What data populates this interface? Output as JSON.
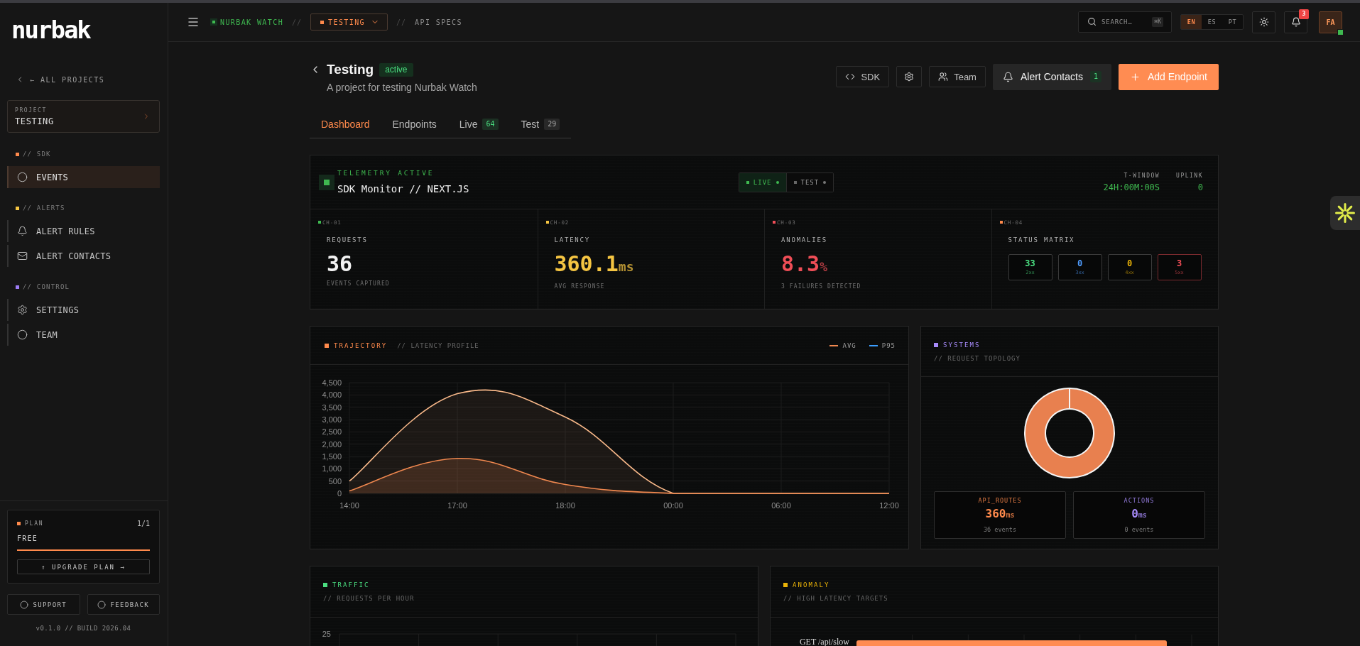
{
  "sidebar": {
    "logo": "nurbak",
    "back_link": "← ALL PROJECTS",
    "project": {
      "label": "PROJECT",
      "name": "TESTING"
    },
    "sections": [
      {
        "title": "// SDK",
        "color": "#ff8a4c",
        "items": [
          {
            "label": "EVENTS",
            "selected": true
          }
        ]
      },
      {
        "title": "// ALERTS",
        "color": "#f5c542",
        "items": [
          {
            "label": "ALERT RULES",
            "selected": false
          },
          {
            "label": "ALERT CONTACTS",
            "selected": false
          }
        ]
      },
      {
        "title": "// CONTROL",
        "color": "#9d7cf5",
        "items": [
          {
            "label": "SETTINGS",
            "selected": false
          },
          {
            "label": "TEAM",
            "selected": false
          }
        ]
      }
    ],
    "plan": {
      "label": "PLAN",
      "count": "1/1",
      "name": "FREE",
      "level": 1,
      "button": "↑ UPGRADE PLAN →"
    },
    "footer_buttons": [
      {
        "label": "SUPPORT"
      },
      {
        "label": "FEEDBACK"
      }
    ],
    "version": "v0.1.0 // BUILD 2026.04"
  },
  "topbar": {
    "breadcrumb": [
      {
        "kind": "app",
        "label": "NURBAK WATCH"
      },
      {
        "kind": "separator",
        "label": "//"
      },
      {
        "kind": "dropdown",
        "label": "TESTING"
      },
      {
        "kind": "separator",
        "label": "//"
      },
      {
        "kind": "page",
        "label": "API SPECS"
      }
    ],
    "search": {
      "placeholder": "SEARCH…",
      "shortcut": "⌘K"
    },
    "languages": [
      {
        "label": "EN",
        "selected": true
      },
      {
        "label": "ES",
        "selected": false
      },
      {
        "label": "PT",
        "selected": false
      }
    ],
    "notifications": {
      "count": "3"
    },
    "avatar": {
      "initials": "FA",
      "online": true
    }
  },
  "project": {
    "title": "Testing",
    "status": "active",
    "description": "A project for testing Nurbak Watch",
    "actions": [
      {
        "kind": "outline",
        "label": "SDK"
      },
      {
        "kind": "icon"
      },
      {
        "kind": "outline",
        "label": "Team"
      },
      {
        "kind": "dark",
        "label": "Alert Contacts",
        "badge": "1"
      },
      {
        "kind": "primary",
        "label": "Add Endpoint"
      }
    ]
  },
  "tabs": [
    {
      "label": "Dashboard",
      "selected": true
    },
    {
      "label": "Endpoints",
      "selected": false
    },
    {
      "label": "Live",
      "selected": false,
      "badge": {
        "text": "64",
        "color": "#4ade80"
      }
    },
    {
      "label": "Test",
      "selected": false,
      "badge": {
        "text": "29",
        "color": "#a3a3a3"
      }
    }
  ],
  "telemetry": {
    "status": "TELEMETRY ACTIVE",
    "active": true,
    "title": "SDK Monitor // NEXT.JS",
    "modes": [
      {
        "label": "LIVE",
        "selected": true
      },
      {
        "label": "TEST",
        "selected": false
      }
    ],
    "stats": [
      {
        "label": "T-WINDOW",
        "value": "24H:00M:00S"
      },
      {
        "label": "UPLINK",
        "value": "0"
      }
    ],
    "channels": [
      {
        "kind": "metric",
        "channel": "CH-01",
        "color": "#3fb950",
        "label": "REQUESTS",
        "value": {
          "text": "36",
          "color": "#f2f2f2"
        },
        "caption": "EVENTS CAPTURED"
      },
      {
        "kind": "metric",
        "channel": "CH-02",
        "color": "#f5c542",
        "label": "LATENCY",
        "value": {
          "text": "360.1",
          "unit": "ms",
          "color": "#f5c542"
        },
        "caption": "AVG RESPONSE"
      },
      {
        "kind": "metric",
        "channel": "CH-03",
        "color": "#f04e57",
        "label": "ANOMALIES",
        "value": {
          "text": "8.3",
          "unit": "%",
          "color": "#f04e57"
        },
        "caption": "3 FAILURES DETECTED"
      },
      {
        "kind": "matrix",
        "channel": "CH-04",
        "color": "#ff8a4c",
        "label": "STATUS MATRIX",
        "statuses": [
          {
            "count": "33",
            "label": "2xx",
            "color": "#4ade80",
            "highlighted": false
          },
          {
            "count": "0",
            "label": "3xx",
            "color": "#4f9dff",
            "highlighted": false
          },
          {
            "count": "0",
            "label": "4xx",
            "color": "#eab308",
            "highlighted": false
          },
          {
            "count": "3",
            "label": "5xx",
            "color": "#f04e57",
            "highlighted": true
          }
        ]
      }
    ]
  },
  "trajectory": {
    "title": "TRAJECTORY",
    "subtitle": "// LATENCY PROFILE",
    "color": "#ff8a4c",
    "legend": [
      {
        "color": "#f0884f"
      },
      {
        "color": "#3b9eff"
      }
    ],
    "chart_data": {
      "type": "area",
      "grid": true,
      "categories": [
        "14:00",
        "17:00",
        "18:00",
        "00:00",
        "06:00",
        "12:00"
      ],
      "series": [
        {
          "name": "AVG",
          "color": "#f0884f",
          "values": [
            100,
            1420,
            360,
            0,
            0,
            0
          ]
        },
        {
          "name": "P95",
          "color": "#f9b98a",
          "values": [
            500,
            4050,
            3100,
            0,
            0,
            0
          ]
        }
      ],
      "ylim": [
        0,
        4500
      ],
      "yticks": [
        0,
        500,
        {
          "value": 1000,
          "label": "1,000"
        },
        {
          "value": 1500,
          "label": "1,500"
        },
        {
          "value": 2000,
          "label": "2,000"
        },
        {
          "value": 2500,
          "label": "2,500"
        },
        {
          "value": 3000,
          "label": "3,000"
        },
        {
          "value": 3500,
          "label": "3,500"
        },
        {
          "value": 4000,
          "label": "4,000"
        },
        {
          "value": 4500,
          "label": "4,500"
        }
      ]
    }
  },
  "systems": {
    "title": "SYSTEMS",
    "subtitle": "// REQUEST TOPOLOGY",
    "color": "#a78bfa",
    "summaries": [
      {
        "label": "API_ROUTES",
        "value": "360",
        "unit": "ms",
        "caption": "36 events",
        "color": "#ff8a4c"
      },
      {
        "label": "ACTIONS",
        "value": "0",
        "unit": "ms",
        "caption": "0 events",
        "color": "#a78bfa"
      }
    ]
  },
  "traffic": {
    "title": "TRAFFIC",
    "subtitle": "// REQUESTS PER HOUR",
    "color": "#4ade80",
    "y_labels": [
      "25"
    ]
  },
  "anomaly": {
    "title": "ANOMALY",
    "subtitle": "// HIGH LATENCY TARGETS",
    "color": "#eab308",
    "targets": [
      {
        "label": "GET /api/slow"
      }
    ]
  }
}
